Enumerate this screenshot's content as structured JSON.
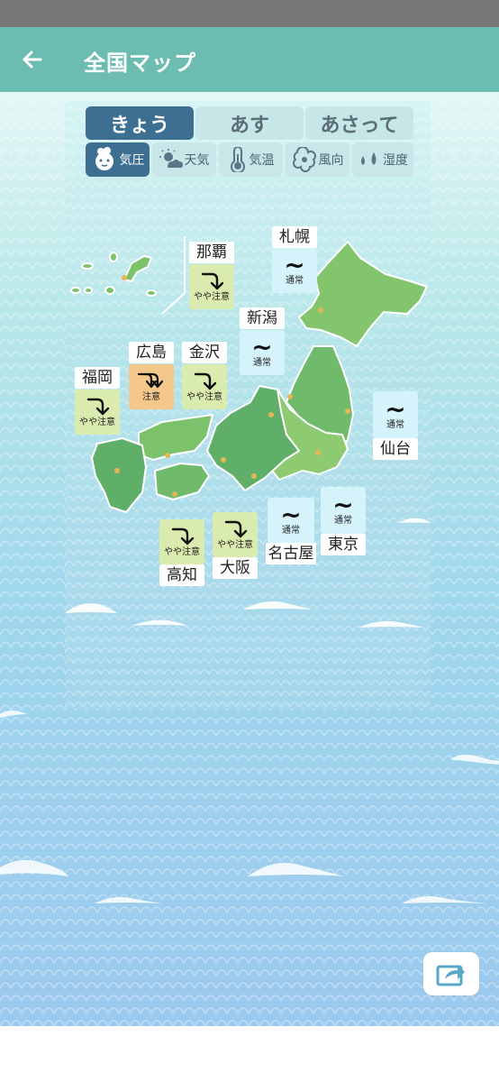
{
  "app_bar": {
    "title": "全国マップ",
    "back_icon": "arrow-left-icon"
  },
  "day_tabs": [
    {
      "label": "きょう",
      "active": true
    },
    {
      "label": "あす",
      "active": false
    },
    {
      "label": "あさって",
      "active": false
    }
  ],
  "category_tabs": [
    {
      "label": "気圧",
      "icon": "mascot-icon",
      "active": true
    },
    {
      "label": "天気",
      "icon": "sun-cloud-icon",
      "active": false
    },
    {
      "label": "気温",
      "icon": "thermometer-icon",
      "active": false
    },
    {
      "label": "風向",
      "icon": "wind-icon",
      "active": false
    },
    {
      "label": "湿度",
      "icon": "droplets-icon",
      "active": false
    }
  ],
  "cities": [
    {
      "name": "那覇",
      "status": "やや注意",
      "level": "caution",
      "icon": "arrow-down-right-icon"
    },
    {
      "name": "札幌",
      "status": "通常",
      "level": "normal",
      "icon": "tilde-icon"
    },
    {
      "name": "新潟",
      "status": "通常",
      "level": "normal",
      "icon": "tilde-icon"
    },
    {
      "name": "広島",
      "status": "注意",
      "level": "warning",
      "icon": "double-arrow-down-icon"
    },
    {
      "name": "金沢",
      "status": "やや注意",
      "level": "caution",
      "icon": "arrow-down-right-icon"
    },
    {
      "name": "福岡",
      "status": "やや注意",
      "level": "caution",
      "icon": "arrow-down-right-icon"
    },
    {
      "name": "仙台",
      "status": "通常",
      "level": "normal",
      "icon": "tilde-icon"
    },
    {
      "name": "名古屋",
      "status": "通常",
      "level": "normal",
      "icon": "tilde-icon"
    },
    {
      "name": "東京",
      "status": "通常",
      "level": "normal",
      "icon": "tilde-icon"
    },
    {
      "name": "高知",
      "status": "やや注意",
      "level": "caution",
      "icon": "arrow-down-right-icon"
    },
    {
      "name": "大阪",
      "status": "やや注意",
      "level": "caution",
      "icon": "arrow-down-right-icon"
    }
  ],
  "share": {
    "icon": "share-icon"
  },
  "colors": {
    "app_bar": "#6cbcb1",
    "active_tab": "#3d6f93",
    "land": "#7cc26b",
    "caution": "#d9ebae",
    "warning": "#f4c88c",
    "normal": "#d5f3fb"
  }
}
